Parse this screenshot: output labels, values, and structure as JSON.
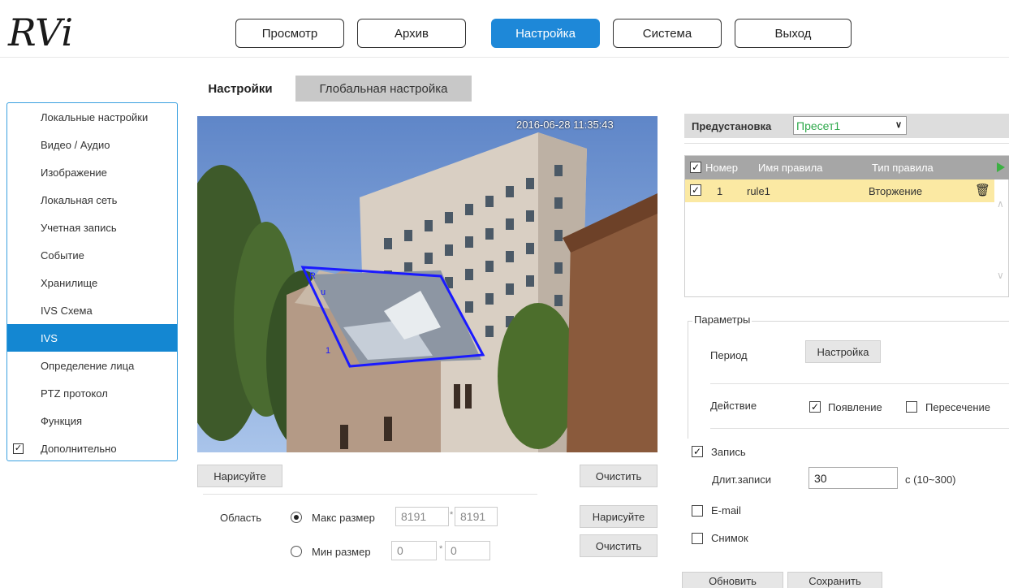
{
  "logo": {
    "text": "RVi"
  },
  "nav": {
    "items": [
      {
        "label": "Просмотр"
      },
      {
        "label": "Архив"
      },
      {
        "label": "Настройка"
      },
      {
        "label": "Система"
      },
      {
        "label": "Выход"
      }
    ],
    "active_index": 2
  },
  "sidebar": {
    "items": [
      {
        "label": "Локальные настройки"
      },
      {
        "label": "Видео / Аудио"
      },
      {
        "label": "Изображение"
      },
      {
        "label": "Локальная сеть"
      },
      {
        "label": "Учетная запись"
      },
      {
        "label": "Событие"
      },
      {
        "label": "Хранилище"
      },
      {
        "label": "IVS Схема"
      },
      {
        "label": "IVS"
      },
      {
        "label": "Определение лица"
      },
      {
        "label": "PTZ протокол"
      },
      {
        "label": "Функция"
      },
      {
        "label": "Дополнительно"
      }
    ],
    "active_index": 8,
    "check_mark": "✓"
  },
  "tabs": {
    "settings": "Настройки",
    "global": "Глобальная настройка"
  },
  "video": {
    "timestamp": "2016-06-28 11:35:43"
  },
  "draw_panel": {
    "draw_label": "Нарисуйте",
    "clear_label": "Очистить",
    "area_label": "Область",
    "max_size_label": "Макс размер",
    "min_size_label": "Мин размер",
    "max_w": "8191",
    "max_h": "8191",
    "min_w": "0",
    "min_h": "0",
    "times": "*",
    "max_selected": true
  },
  "preset": {
    "label": "Предустановка",
    "value": "Пресет1"
  },
  "rules": {
    "headers": {
      "number": "Номер",
      "name": "Имя правила",
      "type": "Тип правила"
    },
    "rows": [
      {
        "number": "1",
        "name": "rule1",
        "type": "Вторжение",
        "checked": true
      }
    ]
  },
  "params": {
    "legend": "Параметры",
    "period_label": "Период",
    "period_button": "Настройка",
    "action_label": "Действие",
    "appear_label": "Появление",
    "appear_checked": true,
    "cross_label": "Пересечение",
    "cross_checked": false
  },
  "record": {
    "label": "Запись",
    "checked": true,
    "duration_label": "Длит.записи",
    "duration_value": "30",
    "duration_unit": "с (10~300)"
  },
  "email": {
    "label": "E-mail",
    "checked": false
  },
  "snapshot": {
    "label": "Снимок",
    "checked": false
  },
  "footer": {
    "refresh": "Обновить",
    "save": "Сохранить"
  },
  "colors": {
    "accent": "#1487d2",
    "rule_row": "#fbe9a3",
    "preset_text": "#2da84a",
    "zone_line": "#1a1aff"
  }
}
